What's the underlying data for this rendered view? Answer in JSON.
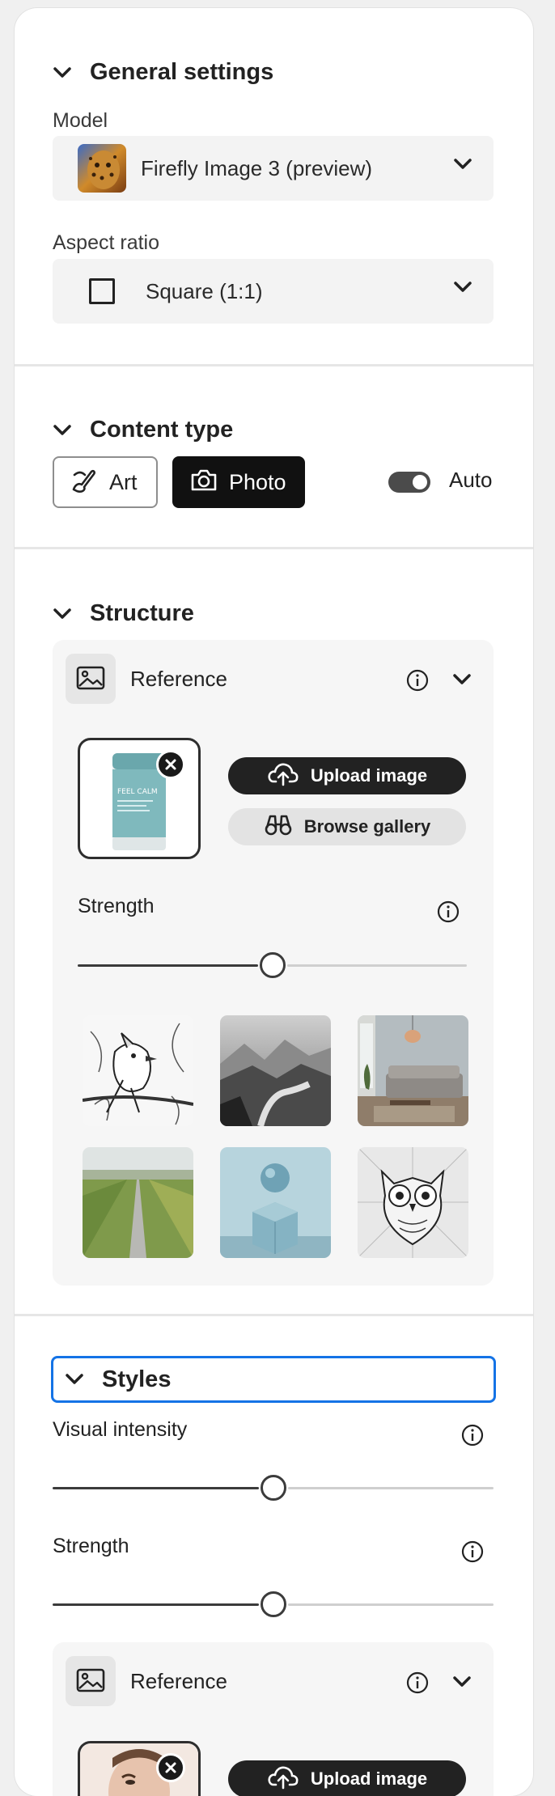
{
  "general": {
    "title": "General settings",
    "model_label": "Model",
    "model_value": "Firefly Image 3 (preview)",
    "aspect_label": "Aspect ratio",
    "aspect_value": "Square (1:1)"
  },
  "content_type": {
    "title": "Content type",
    "art_label": "Art",
    "photo_label": "Photo",
    "auto_label": "Auto",
    "auto_on": true,
    "selected": "Photo"
  },
  "structure": {
    "title": "Structure",
    "reference_label": "Reference",
    "upload_label": "Upload image",
    "browse_label": "Browse gallery",
    "strength_label": "Strength",
    "strength_value": 0.5,
    "thumb_text": "FEEL CALM",
    "gallery": [
      {
        "name": "bird-sketch"
      },
      {
        "name": "misty-mountains"
      },
      {
        "name": "living-room"
      },
      {
        "name": "field-road"
      },
      {
        "name": "sphere-cube"
      },
      {
        "name": "owl-sketch"
      }
    ]
  },
  "styles": {
    "title": "Styles",
    "visual_intensity_label": "Visual intensity",
    "visual_intensity_value": 0.5,
    "strength_label": "Strength",
    "strength_value": 0.5,
    "reference_label": "Reference",
    "upload_label": "Upload image"
  },
  "colors": {
    "focus_ring": "#1473e6",
    "dark": "#111111",
    "panel_bg": "#ffffff"
  }
}
